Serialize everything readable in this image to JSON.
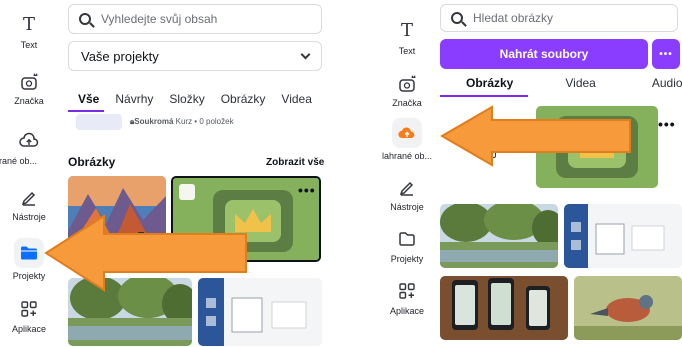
{
  "left": {
    "sidebar": [
      {
        "label": "Text",
        "icon": "text-icon"
      },
      {
        "label": "Značka",
        "icon": "crown-brand-icon"
      },
      {
        "label": "lhrané ob...",
        "icon": "cloud-upload-icon"
      },
      {
        "label": "Nástroje",
        "icon": "pen-tool-icon"
      },
      {
        "label": "Projekty",
        "icon": "folder-icon"
      },
      {
        "label": "Aplikace",
        "icon": "apps-icon"
      }
    ],
    "search_placeholder": "Vyhledejte svůj obsah",
    "projects_select": "Vaše projekty",
    "tabs": [
      "Vše",
      "Návrhy",
      "Složky",
      "Obrázky",
      "Videa"
    ],
    "folder_meta_badge": "Soukromá",
    "folder_meta_text": "Kurz • 0 položek",
    "images_title": "Obrázky",
    "see_all": "Zobrazit vše",
    "more_dots": "•••"
  },
  "right": {
    "sidebar": [
      {
        "label": "Text",
        "icon": "text-icon"
      },
      {
        "label": "Značka",
        "icon": "crown-brand-icon"
      },
      {
        "label": "lahrané ob...",
        "icon": "cloud-upload-icon"
      },
      {
        "label": "Nástroje",
        "icon": "pen-tool-icon"
      },
      {
        "label": "Projekty",
        "icon": "folder-icon"
      },
      {
        "label": "Aplikace",
        "icon": "apps-icon"
      }
    ],
    "search_placeholder": "Hledat obrázky",
    "upload_button": "Nahrát soubory",
    "more_button": "•••",
    "tabs": [
      "Obrázky",
      "Videa",
      "Audio"
    ],
    "more_dots": "•••"
  },
  "colors": {
    "accent_purple": "#8b3dff",
    "arrow_orange": "#f79a3c",
    "active_blue": "#0d6fff",
    "upload_orange": "#ff7a1a"
  }
}
